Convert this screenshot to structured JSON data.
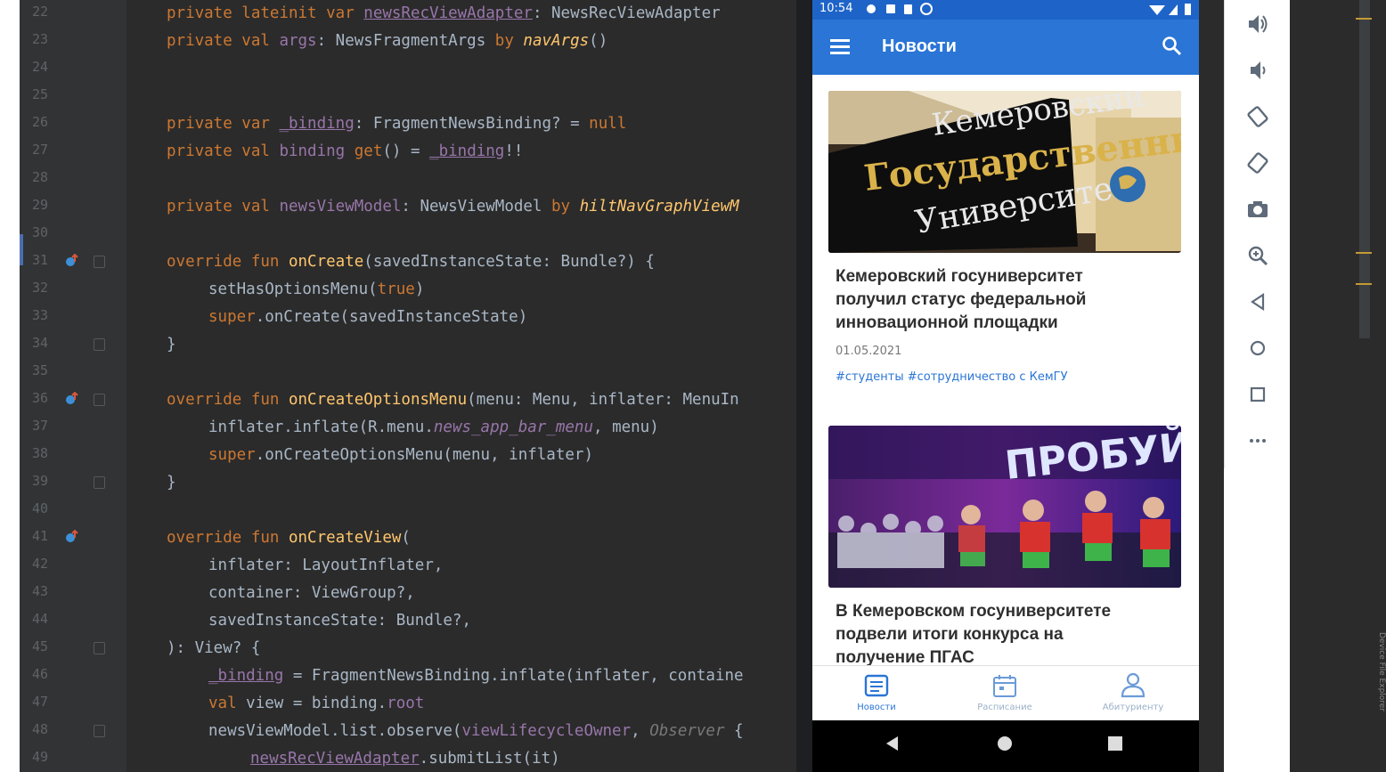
{
  "editor": {
    "lines": [
      {
        "num": "22",
        "marker": "",
        "fold": false,
        "indent": 0,
        "tokens": [
          [
            "private ",
            "kw"
          ],
          [
            "lateinit ",
            "kw"
          ],
          [
            "var ",
            "kw"
          ],
          [
            "newsRecViewAdapter",
            "und"
          ],
          [
            ": NewsRecViewAdapter",
            "id"
          ]
        ]
      },
      {
        "num": "23",
        "marker": "",
        "fold": false,
        "indent": 0,
        "tokens": [
          [
            "private ",
            "kw"
          ],
          [
            "val ",
            "kw"
          ],
          [
            "args",
            "prop"
          ],
          [
            ": NewsFragmentArgs ",
            "id"
          ],
          [
            "by ",
            "kw"
          ],
          [
            "navArgs",
            "ital"
          ],
          [
            "()",
            "id"
          ]
        ]
      },
      {
        "num": "24",
        "marker": "",
        "fold": false,
        "indent": 0,
        "tokens": []
      },
      {
        "num": "25",
        "marker": "",
        "fold": false,
        "indent": 0,
        "tokens": []
      },
      {
        "num": "26",
        "marker": "",
        "fold": false,
        "indent": 0,
        "tokens": [
          [
            "private ",
            "kw"
          ],
          [
            "var ",
            "kw"
          ],
          [
            "_binding",
            "und"
          ],
          [
            ": FragmentNewsBinding? = ",
            "id"
          ],
          [
            "null",
            "kw"
          ]
        ]
      },
      {
        "num": "27",
        "marker": "",
        "fold": false,
        "indent": 0,
        "tokens": [
          [
            "private ",
            "kw"
          ],
          [
            "val ",
            "kw"
          ],
          [
            "binding ",
            "prop"
          ],
          [
            "get",
            "kw"
          ],
          [
            "() = ",
            "id"
          ],
          [
            "_binding",
            "und"
          ],
          [
            "!!",
            "id"
          ]
        ]
      },
      {
        "num": "28",
        "marker": "",
        "fold": false,
        "indent": 0,
        "tokens": []
      },
      {
        "num": "29",
        "marker": "",
        "fold": false,
        "indent": 0,
        "tokens": [
          [
            "private ",
            "kw"
          ],
          [
            "val ",
            "kw"
          ],
          [
            "newsViewModel",
            "prop"
          ],
          [
            ": NewsViewModel ",
            "id"
          ],
          [
            "by ",
            "kw"
          ],
          [
            "hiltNavGraphViewM",
            "ital"
          ]
        ]
      },
      {
        "num": "30",
        "marker": "",
        "fold": false,
        "indent": 0,
        "tokens": []
      },
      {
        "num": "31",
        "marker": "override",
        "fold": true,
        "indent": 0,
        "tokens": [
          [
            "override ",
            "kw"
          ],
          [
            "fun ",
            "kw"
          ],
          [
            "onCreate",
            "fn"
          ],
          [
            "(savedInstanceState: Bundle?) {",
            "id"
          ]
        ]
      },
      {
        "num": "32",
        "marker": "",
        "fold": false,
        "indent": 1,
        "tokens": [
          [
            "setHasOptionsMenu(",
            "id"
          ],
          [
            "true",
            "kw"
          ],
          [
            ")",
            "id"
          ]
        ]
      },
      {
        "num": "33",
        "marker": "",
        "fold": false,
        "indent": 1,
        "tokens": [
          [
            "super",
            "kw"
          ],
          [
            ".onCreate(savedInstanceState)",
            "id"
          ]
        ]
      },
      {
        "num": "34",
        "marker": "",
        "fold": true,
        "indent": 0,
        "tokens": [
          [
            "}",
            "id"
          ]
        ]
      },
      {
        "num": "35",
        "marker": "",
        "fold": false,
        "indent": 0,
        "tokens": []
      },
      {
        "num": "36",
        "marker": "override",
        "fold": true,
        "indent": 0,
        "tokens": [
          [
            "override ",
            "kw"
          ],
          [
            "fun ",
            "kw"
          ],
          [
            "onCreateOptionsMenu",
            "fn"
          ],
          [
            "(menu: Menu, inflater: MenuIn",
            "id"
          ]
        ]
      },
      {
        "num": "37",
        "marker": "",
        "fold": false,
        "indent": 1,
        "tokens": [
          [
            "inflater.inflate(R.menu.",
            "id"
          ],
          [
            "news_app_bar_menu",
            "res"
          ],
          [
            ", menu)",
            "id"
          ]
        ]
      },
      {
        "num": "38",
        "marker": "",
        "fold": false,
        "indent": 1,
        "tokens": [
          [
            "super",
            "kw"
          ],
          [
            ".onCreateOptionsMenu(menu, inflater)",
            "id"
          ]
        ]
      },
      {
        "num": "39",
        "marker": "",
        "fold": true,
        "indent": 0,
        "tokens": [
          [
            "}",
            "id"
          ]
        ]
      },
      {
        "num": "40",
        "marker": "",
        "fold": false,
        "indent": 0,
        "tokens": []
      },
      {
        "num": "41",
        "marker": "override",
        "fold": false,
        "indent": 0,
        "tokens": [
          [
            "override ",
            "kw"
          ],
          [
            "fun ",
            "kw"
          ],
          [
            "onCreateView",
            "fn"
          ],
          [
            "(",
            "id"
          ]
        ]
      },
      {
        "num": "42",
        "marker": "",
        "fold": false,
        "indent": 1,
        "tokens": [
          [
            "inflater: LayoutInflater,",
            "id"
          ]
        ]
      },
      {
        "num": "43",
        "marker": "",
        "fold": false,
        "indent": 1,
        "tokens": [
          [
            "container: ViewGroup?,",
            "id"
          ]
        ]
      },
      {
        "num": "44",
        "marker": "",
        "fold": false,
        "indent": 1,
        "tokens": [
          [
            "savedInstanceState: Bundle?,",
            "id"
          ]
        ]
      },
      {
        "num": "45",
        "marker": "",
        "fold": true,
        "indent": 0,
        "tokens": [
          [
            "): View? {",
            "id"
          ]
        ]
      },
      {
        "num": "46",
        "marker": "",
        "fold": false,
        "indent": 1,
        "tokens": [
          [
            "_binding",
            "und"
          ],
          [
            " = FragmentNewsBinding.inflate(inflater, containe",
            "id"
          ]
        ]
      },
      {
        "num": "47",
        "marker": "",
        "fold": false,
        "indent": 1,
        "tokens": [
          [
            "val ",
            "kw"
          ],
          [
            "view = binding.",
            "id"
          ],
          [
            "root",
            "prop"
          ]
        ]
      },
      {
        "num": "48",
        "marker": "",
        "fold": true,
        "indent": 1,
        "tokens": [
          [
            "newsViewModel.list.observe(",
            "id"
          ],
          [
            "viewLifecycleOwner",
            "prop"
          ],
          [
            ", ",
            "id"
          ],
          [
            "Observer",
            "muted"
          ],
          [
            " {",
            "id"
          ]
        ]
      },
      {
        "num": "49",
        "marker": "",
        "fold": false,
        "indent": 2,
        "tokens": [
          [
            "newsRecViewAdapter",
            "und"
          ],
          [
            ".submitList(it)",
            "id"
          ]
        ]
      }
    ]
  },
  "phone": {
    "status": {
      "time": "10:54"
    },
    "appbar": {
      "title": "Новости"
    },
    "news": [
      {
        "title_lines": [
          "Кемеровский госуниверситет",
          "получил статус федеральной",
          "инновационной площадки"
        ],
        "date": "01.05.2021",
        "tags": "#студенты #сотрудничество с КемГУ",
        "image": "university-building-sign"
      },
      {
        "title_lines": [
          "В Кемеровском госуниверситете",
          "подвели итоги конкурса на",
          "получение ПГАС"
        ],
        "date": "",
        "tags": "",
        "image": "students-dance-stage"
      }
    ],
    "image_texts": {
      "sign_line1": "Кемеровский",
      "sign_line2": "Государственный",
      "sign_line3": "Университет",
      "stage_banner": "ПРОБУЙ"
    },
    "bottom_nav": [
      {
        "label": "Новости",
        "icon": "news-icon",
        "active": true
      },
      {
        "label": "Расписание",
        "icon": "calendar-icon",
        "active": false
      },
      {
        "label": "Абитуриенту",
        "icon": "person-icon",
        "active": false
      }
    ]
  },
  "side_panel": {
    "label": "Device File Explorer"
  },
  "colors": {
    "ide_bg": "#2b2b2b",
    "appbar": "#2a75d6",
    "accent": "#2a75d6"
  }
}
